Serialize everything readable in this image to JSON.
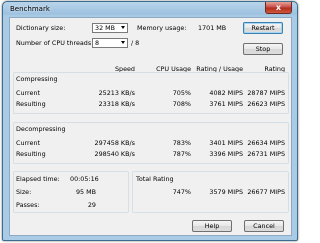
{
  "window": {
    "title": "Benchmark",
    "close_glyph": "x"
  },
  "settings": {
    "dictionary_label": "Dictionary size:",
    "dictionary_value": "32 MB",
    "threads_label": "Number of CPU threads:",
    "threads_value": "8",
    "threads_total": "/ 8",
    "memory_label": "Memory usage:",
    "memory_value": "1701 MB"
  },
  "buttons": {
    "restart": "Restart",
    "stop": "Stop",
    "help": "Help",
    "cancel": "Cancel"
  },
  "columns": {
    "speed": "Speed",
    "cpu_usage": "CPU Usage",
    "rating_usage": "Rating / Usage",
    "rating": "Rating"
  },
  "compressing": {
    "title": "Compressing",
    "rows": [
      {
        "label": "Current",
        "speed": "25213 KB/s",
        "cpu": "705%",
        "rating_usage": "4082 MIPS",
        "rating": "28787 MIPS"
      },
      {
        "label": "Resulting",
        "speed": "23318 KB/s",
        "cpu": "708%",
        "rating_usage": "3761 MIPS",
        "rating": "26623 MIPS"
      }
    ]
  },
  "decompressing": {
    "title": "Decompressing",
    "rows": [
      {
        "label": "Current",
        "speed": "297458 KB/s",
        "cpu": "783%",
        "rating_usage": "3401 MIPS",
        "rating": "26634 MIPS"
      },
      {
        "label": "Resulting",
        "speed": "298540 KB/s",
        "cpu": "787%",
        "rating_usage": "3396 MIPS",
        "rating": "26731 MIPS"
      }
    ]
  },
  "stats": {
    "elapsed_label": "Elapsed time:",
    "elapsed_value": "00:05:16",
    "size_label": "Size:",
    "size_value": "95 MB",
    "passes_label": "Passes:",
    "passes_value": "29"
  },
  "total": {
    "label": "Total Rating",
    "cpu": "747%",
    "rating_usage": "3579 MIPS",
    "rating": "26677 MIPS"
  },
  "colors": {
    "title_gradient_top": "#b8d4ea",
    "close_red": "#c75050",
    "client_bg": "#f0f0f0"
  }
}
